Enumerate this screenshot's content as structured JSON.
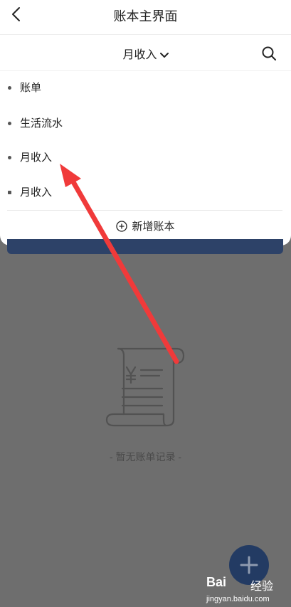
{
  "header": {
    "back_icon": "chevron-left-icon",
    "title": "账本主界面"
  },
  "selector": {
    "current_book": "月收入",
    "chevron_icon": "chevron-down-icon",
    "search_icon": "search-icon"
  },
  "book_list": [
    {
      "label": "账单"
    },
    {
      "label": "生活流水"
    },
    {
      "label": "月收入"
    },
    {
      "label": "月收入"
    }
  ],
  "add_book": {
    "icon": "plus-circle-icon",
    "label": "新增账本"
  },
  "empty_state": {
    "icon": "receipt-scroll-icon",
    "text": "- 暂无账单记录 -"
  },
  "fab": {
    "icon": "plus-icon"
  },
  "annotation": {
    "type": "red-arrow",
    "color": "#f03a3a"
  },
  "watermark": {
    "logo": "Bai",
    "text": "经验",
    "url": "jingyan.baidu.com"
  },
  "colors": {
    "overlay": "#6e6e6e",
    "accent_blue": "#233b63",
    "arrow_red": "#f03a3a"
  }
}
